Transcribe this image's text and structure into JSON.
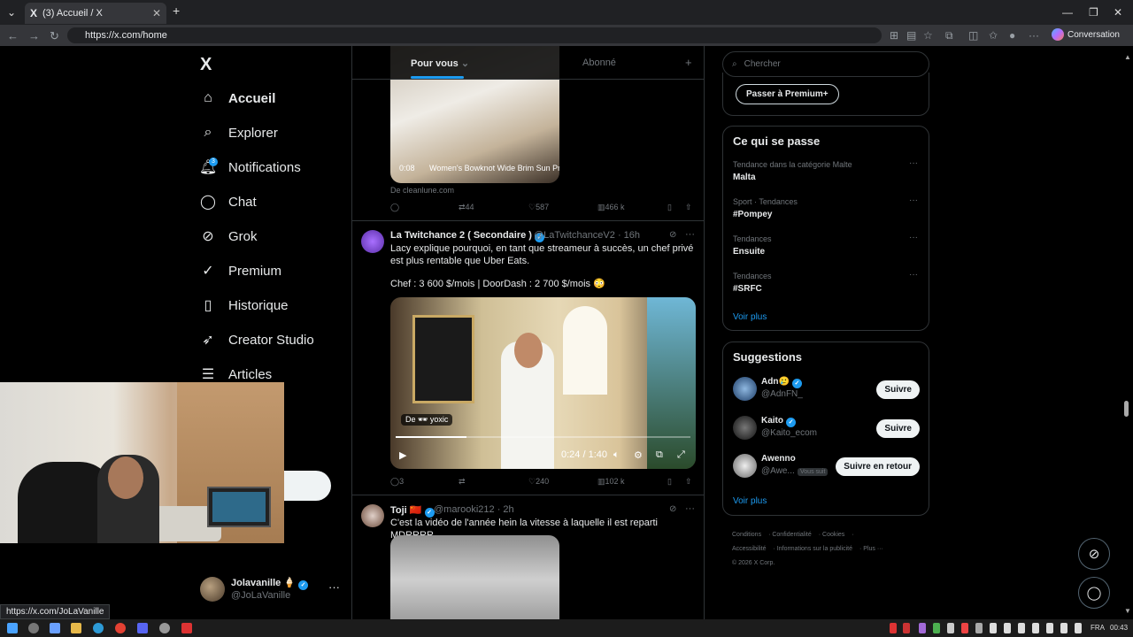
{
  "browser": {
    "tab_title": "(3) Accueil / X",
    "tab_logo": "X",
    "url": "https://x.com/home",
    "conversation_label": "Conversation",
    "status_url": "https://x.com/JoLaVanille"
  },
  "nav": {
    "logo": "X",
    "items": [
      {
        "label": "Accueil",
        "icon": "home-icon",
        "glyph": "⌂"
      },
      {
        "label": "Explorer",
        "icon": "search-icon",
        "glyph": "⌕"
      },
      {
        "label": "Notifications",
        "icon": "bell-icon",
        "glyph": "🔔︎"
      },
      {
        "label": "Chat",
        "icon": "chat-icon",
        "glyph": "◯"
      },
      {
        "label": "Grok",
        "icon": "grok-icon",
        "glyph": "⊘"
      },
      {
        "label": "Premium",
        "icon": "premium-icon",
        "glyph": "✓"
      },
      {
        "label": "Historique",
        "icon": "bookmark-icon",
        "glyph": "▯"
      },
      {
        "label": "Creator Studio",
        "icon": "rocket-icon",
        "glyph": "➶"
      },
      {
        "label": "Articles",
        "icon": "article-icon",
        "glyph": "☰"
      }
    ],
    "notif_count": "3",
    "profile": {
      "name": "Jolavanille 🍦",
      "handle": "@JoLaVanille",
      "more": "···"
    }
  },
  "timeline": {
    "tabs": {
      "for_you": "Pour vous",
      "following": "Abonné",
      "add": "+"
    },
    "tweet1": {
      "media_time": "0:08",
      "media_caption": "Women's Bowknot Wide Brim Sun Pr...",
      "source": "De cleanlune.com",
      "retweets": "44",
      "likes": "587",
      "views": "466 k"
    },
    "tweet2": {
      "name": "La Twitchance 2 ( Secondaire )",
      "handle": "@LaTwitchanceV2 · 16h",
      "text1": "Lacy explique pourquoi, en tant que streameur à succès, un chef privé est plus rentable que Uber Eats.",
      "text2": "Chef : 3 600 $/mois | DoorDash : 2 700 $/mois 😳",
      "video_chip": "De 🕶 yoxic",
      "video_time": "0:24 / 1:40",
      "video_progress": 0.24,
      "replies": "3",
      "likes": "240",
      "views": "102 k"
    },
    "tweet3": {
      "name": "Toji 🇨🇳",
      "handle": "@marooki212 · 2h",
      "text": "C'est la vidéo de l'année hein la vitesse à laquelle il est reparti MDRRRR"
    }
  },
  "right": {
    "search_placeholder": "Chercher",
    "premium_btn": "Passer à Premium+",
    "trends_title": "Ce qui se passe",
    "trends": [
      {
        "meta": "Tendance dans la catégorie Malte",
        "name": "Malta"
      },
      {
        "meta": "Sport · Tendances",
        "name": "#Pompey"
      },
      {
        "meta": "Tendances",
        "name": "Ensuite"
      },
      {
        "meta": "Tendances",
        "name": "#SRFC"
      }
    ],
    "trends_more": "Voir plus",
    "suggestions_title": "Suggestions",
    "suggestions": [
      {
        "name": "Adn🥲",
        "handle": "@AdnFN_",
        "btn": "Suivre"
      },
      {
        "name": "Kaito",
        "handle": "@Kaito_ecom",
        "btn": "Suivre"
      },
      {
        "name": "Awenno",
        "handle": "@Awe...",
        "badge": "Vous suit",
        "btn": "Suivre en retour"
      }
    ],
    "suggestions_more": "Voir plus",
    "footer": {
      "l1": [
        "Conditions",
        "Confidentialité",
        "Cookies"
      ],
      "l2": [
        "Accessibilité",
        "Informations sur la publicité",
        "Plus ···"
      ],
      "copyright": "© 2026 X Corp."
    }
  },
  "taskbar": {
    "lang": "FRA",
    "time": "00:43"
  }
}
